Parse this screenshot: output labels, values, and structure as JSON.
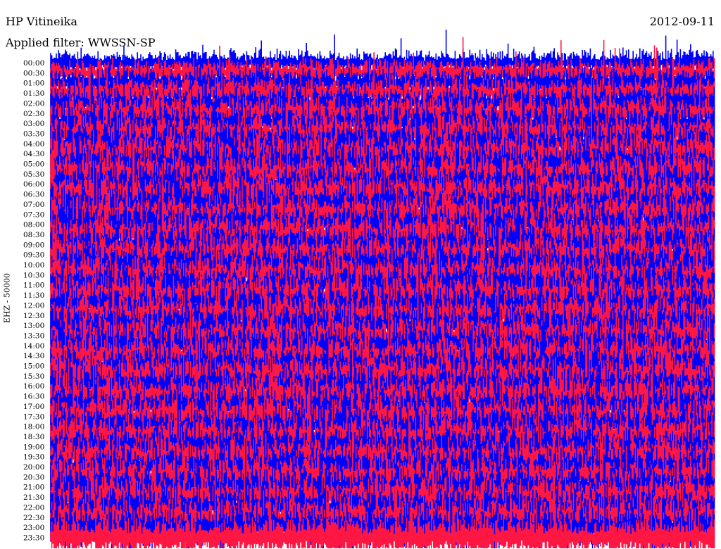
{
  "header": {
    "station": "HP Vitineika",
    "date": "2012-09-11",
    "filter": "Applied filter: WWSSN-SP"
  },
  "chart_data": {
    "type": "line",
    "title": "HP Vitineika",
    "subtitle": "Applied filter: WWSSN-SP",
    "ylabel": "EHZ - 50000",
    "xlabel": "",
    "tick_labels": [
      "00:00",
      "00:30",
      "01:00",
      "01:30",
      "02:00",
      "02:30",
      "03:00",
      "03:30",
      "04:00",
      "04:30",
      "05:00",
      "05:30",
      "06:00",
      "06:30",
      "07:00",
      "07:30",
      "08:00",
      "08:30",
      "09:00",
      "09:30",
      "10:00",
      "10:30",
      "11:00",
      "11:30",
      "12:00",
      "12:30",
      "13:00",
      "13:30",
      "14:00",
      "14:30",
      "15:00",
      "15:30",
      "16:00",
      "16:30",
      "17:00",
      "17:30",
      "18:00",
      "18:30",
      "19:00",
      "19:30",
      "20:00",
      "20:30",
      "21:00",
      "21:30",
      "22:00",
      "22:30",
      "23:00",
      "23:30"
    ],
    "trace_colors": [
      "#0000ff",
      "#ff1744"
    ],
    "grid": false,
    "legend": "none"
  }
}
